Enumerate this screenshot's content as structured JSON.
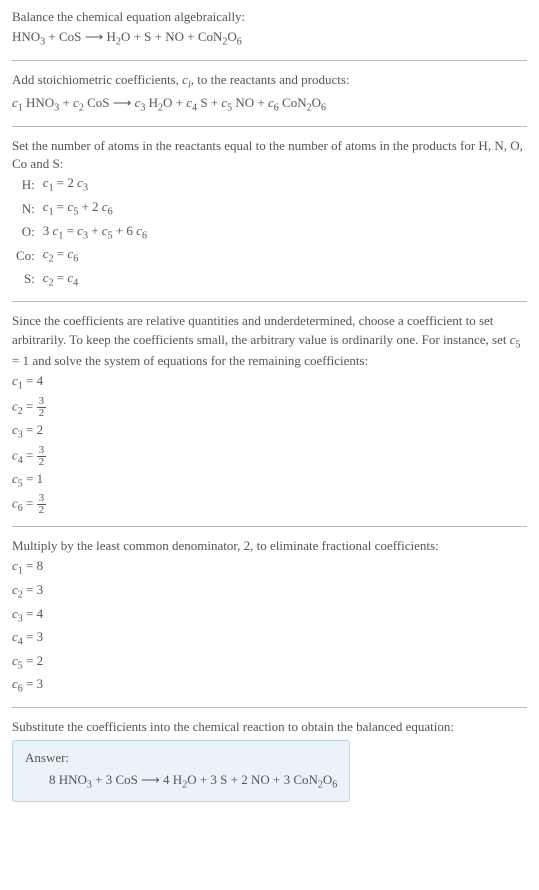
{
  "s1": {
    "title": "Balance the chemical equation algebraically:",
    "eq": "HNO₃ + CoS ⟶ H₂O + S + NO + CoN₂O₆"
  },
  "s2": {
    "title": "Add stoichiometric coefficients, cᵢ, to the reactants and products:",
    "eq": "c₁ HNO₃ + c₂ CoS ⟶ c₃ H₂O + c₄ S + c₅ NO + c₆ CoN₂O₆"
  },
  "s3": {
    "title": "Set the number of atoms in the reactants equal to the number of atoms in the products for H, N, O, Co and S:",
    "rows": [
      {
        "elem": "H:",
        "eq": "c₁ = 2 c₃"
      },
      {
        "elem": "N:",
        "eq": "c₁ = c₅ + 2 c₆"
      },
      {
        "elem": "O:",
        "eq": "3 c₁ = c₃ + c₅ + 6 c₆"
      },
      {
        "elem": "Co:",
        "eq": "c₂ = c₆"
      },
      {
        "elem": "S:",
        "eq": "c₂ = c₄"
      }
    ]
  },
  "s4": {
    "title": "Since the coefficients are relative quantities and underdetermined, choose a coefficient to set arbitrarily. To keep the coefficients small, the arbitrary value is ordinarily one. For instance, set c₅ = 1 and solve the system of equations for the remaining coefficients:",
    "rows": [
      {
        "lhs": "c₁ =",
        "rhs": "4"
      },
      {
        "lhs": "c₂ =",
        "rhs": "3/2"
      },
      {
        "lhs": "c₃ =",
        "rhs": "2"
      },
      {
        "lhs": "c₄ =",
        "rhs": "3/2"
      },
      {
        "lhs": "c₅ =",
        "rhs": "1"
      },
      {
        "lhs": "c₆ =",
        "rhs": "3/2"
      }
    ]
  },
  "s5": {
    "title": "Multiply by the least common denominator, 2, to eliminate fractional coefficients:",
    "rows": [
      {
        "eq": "c₁ = 8"
      },
      {
        "eq": "c₂ = 3"
      },
      {
        "eq": "c₃ = 4"
      },
      {
        "eq": "c₄ = 3"
      },
      {
        "eq": "c₅ = 2"
      },
      {
        "eq": "c₆ = 3"
      }
    ]
  },
  "s6": {
    "title": "Substitute the coefficients into the chemical reaction to obtain the balanced equation:",
    "answer_label": "Answer:",
    "answer_eq": "8 HNO₃ + 3 CoS ⟶ 4 H₂O + 3 S + 2 NO + 3 CoN₂O₆"
  }
}
